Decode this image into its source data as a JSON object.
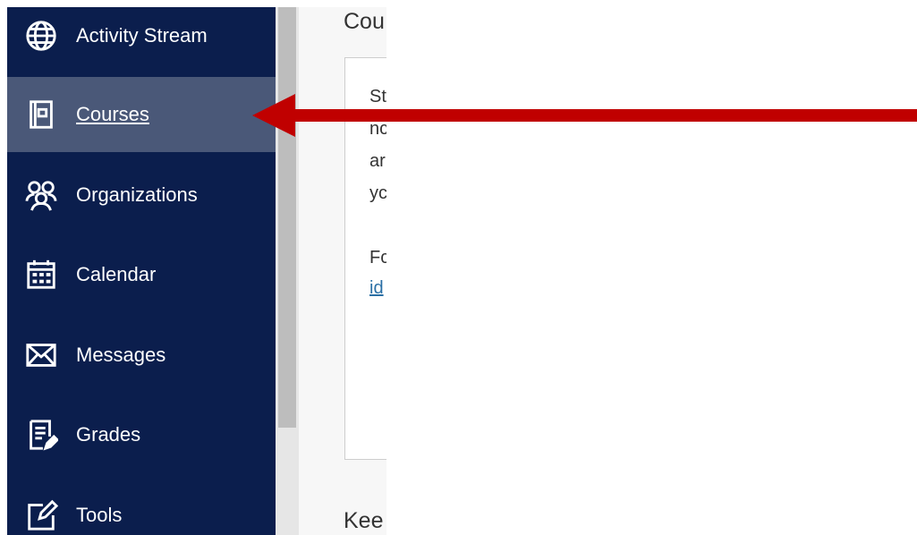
{
  "sidebar": {
    "items": [
      {
        "label": "Activity Stream",
        "icon": "globe-icon"
      },
      {
        "label": "Courses",
        "icon": "book-icon",
        "active": true
      },
      {
        "label": "Organizations",
        "icon": "people-icon"
      },
      {
        "label": "Calendar",
        "icon": "calendar-icon"
      },
      {
        "label": "Messages",
        "icon": "envelope-icon"
      },
      {
        "label": "Grades",
        "icon": "grades-icon"
      },
      {
        "label": "Tools",
        "icon": "tools-icon"
      }
    ]
  },
  "main": {
    "heading": "Cou",
    "card_lines": [
      "St",
      "nc",
      "ar",
      "yc",
      "Fc",
      "id"
    ],
    "heading2": "Kee"
  },
  "annotation": {
    "arrow_color": "#c00000"
  },
  "colors": {
    "sidebar_bg": "#0b1e4d",
    "active_bg": "#4a5878",
    "link": "#2a6fa5"
  }
}
